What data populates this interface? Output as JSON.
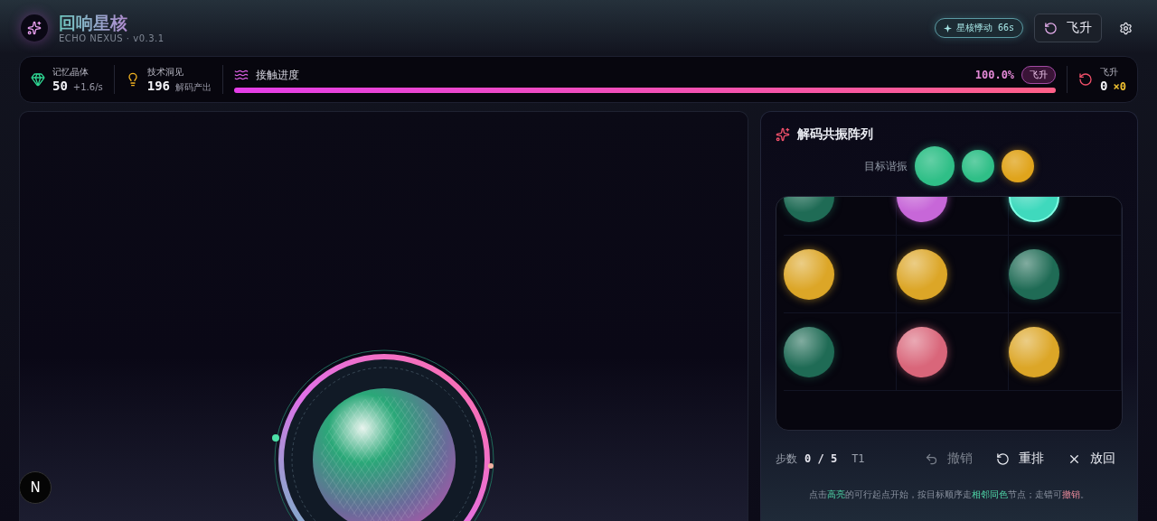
{
  "app": {
    "title": "回响星核",
    "subtitle": "ECHO NEXUS · v0.3.1"
  },
  "header": {
    "status_chip": "星核悸动 66s",
    "ascend_button": "飞升"
  },
  "stats": {
    "crystals": {
      "label": "记忆晶体",
      "value": "50",
      "rate": "+1.6/s"
    },
    "insight": {
      "label": "技术洞见",
      "value": "196",
      "note": "解码产出"
    },
    "progress": {
      "label": "接触进度",
      "level": 1.0,
      "reading": "100.0%",
      "badge": "飞升"
    },
    "ascension": {
      "label": "飞升",
      "value": "0",
      "multiplier": "×0"
    }
  },
  "core": {
    "badge": "N"
  },
  "panel": {
    "title": "解码共振阵列",
    "target_label": "目标谐振",
    "targets": [
      {
        "color": "#2fbf87"
      },
      {
        "color": "#2fbf87"
      },
      {
        "color": "#e0a41c"
      }
    ],
    "nodes": [
      {
        "color": "#1f6b55",
        "highlighted": false
      },
      {
        "color": "#c767d8",
        "highlighted": false
      },
      {
        "color": "#3fd9bd",
        "highlighted": true
      },
      {
        "color": "#dca627",
        "highlighted": false
      },
      {
        "color": "#dca627",
        "highlighted": false
      },
      {
        "color": "#1f6b55",
        "highlighted": false
      },
      {
        "color": "#1f6b55",
        "highlighted": false
      },
      {
        "color": "#d9667a",
        "highlighted": false
      },
      {
        "color": "#dca627",
        "highlighted": false
      }
    ],
    "steps_label": "步数",
    "steps": "0 / 5",
    "tier": "T1",
    "actions": [
      {
        "kind": "undo",
        "label": "撤销",
        "disabled": true
      },
      {
        "kind": "reshuffle",
        "label": "重排",
        "disabled": false
      },
      {
        "kind": "return",
        "label": "放回",
        "disabled": false
      }
    ],
    "hint": [
      {
        "kind": "plain",
        "text": "点击"
      },
      {
        "kind": "highlight",
        "text": "高亮"
      },
      {
        "kind": "plain",
        "text": "的可行起点开始，按目标顺序走"
      },
      {
        "kind": "highlight",
        "text": "相邻同色"
      },
      {
        "kind": "plain",
        "text": "节点；走错可"
      },
      {
        "kind": "warning",
        "text": "撤销"
      },
      {
        "kind": "plain",
        "text": "。"
      }
    ]
  }
}
